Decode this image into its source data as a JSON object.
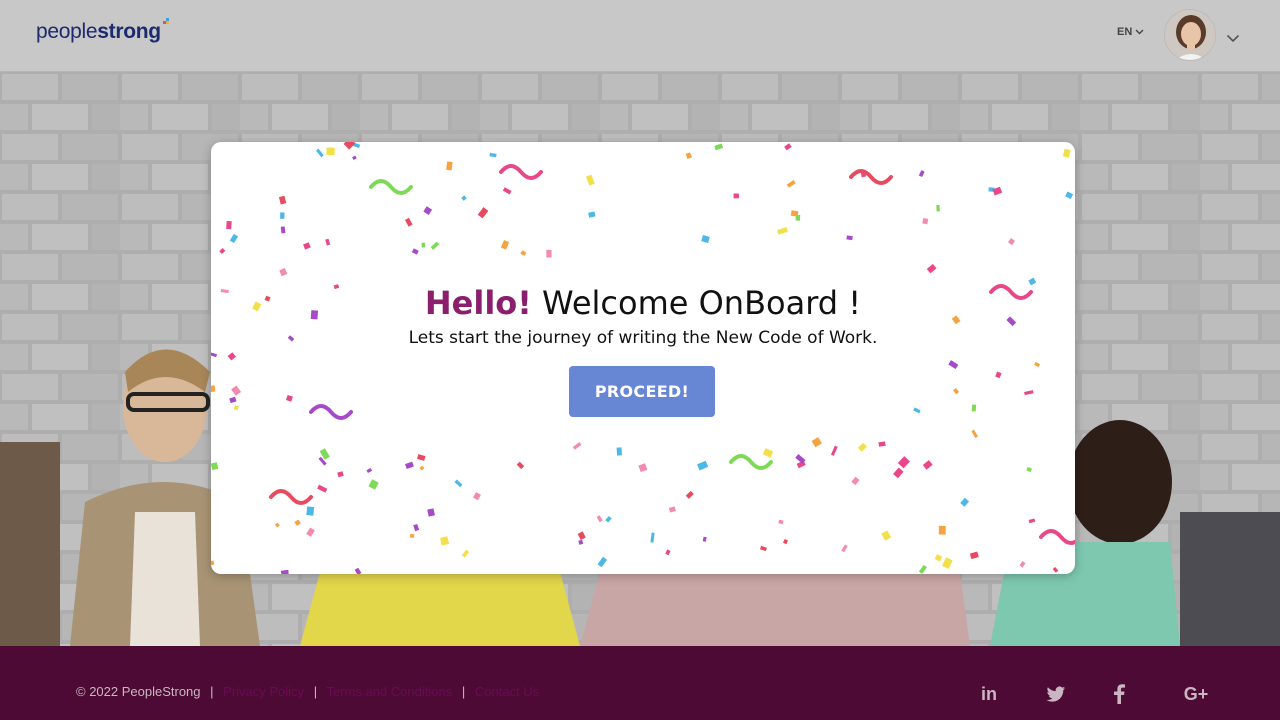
{
  "header": {
    "logo_regular": "people",
    "logo_bold": "strong",
    "language": "EN"
  },
  "modal": {
    "title_hello": "Hello!",
    "title_rest": " Welcome OnBoard !",
    "subtitle": "Lets start the journey of writing the New Code of Work.",
    "button_label": "PROCEED!"
  },
  "footer": {
    "copyright": "© 2022 PeopleStrong",
    "links": [
      "Privacy Policy",
      "Terms and Conditions",
      "Contact Us"
    ],
    "social_icons": [
      "linkedin-icon",
      "twitter-icon",
      "facebook-icon",
      "google-plus-icon"
    ],
    "social_labels": [
      "in",
      "G+"
    ]
  },
  "colors": {
    "header_bg": "#c8c8c8",
    "footer_bg": "#4d0a34",
    "accent_magenta": "#8a1f6e",
    "button_blue": "#6786d4",
    "logo_navy": "#1c2a6e"
  }
}
